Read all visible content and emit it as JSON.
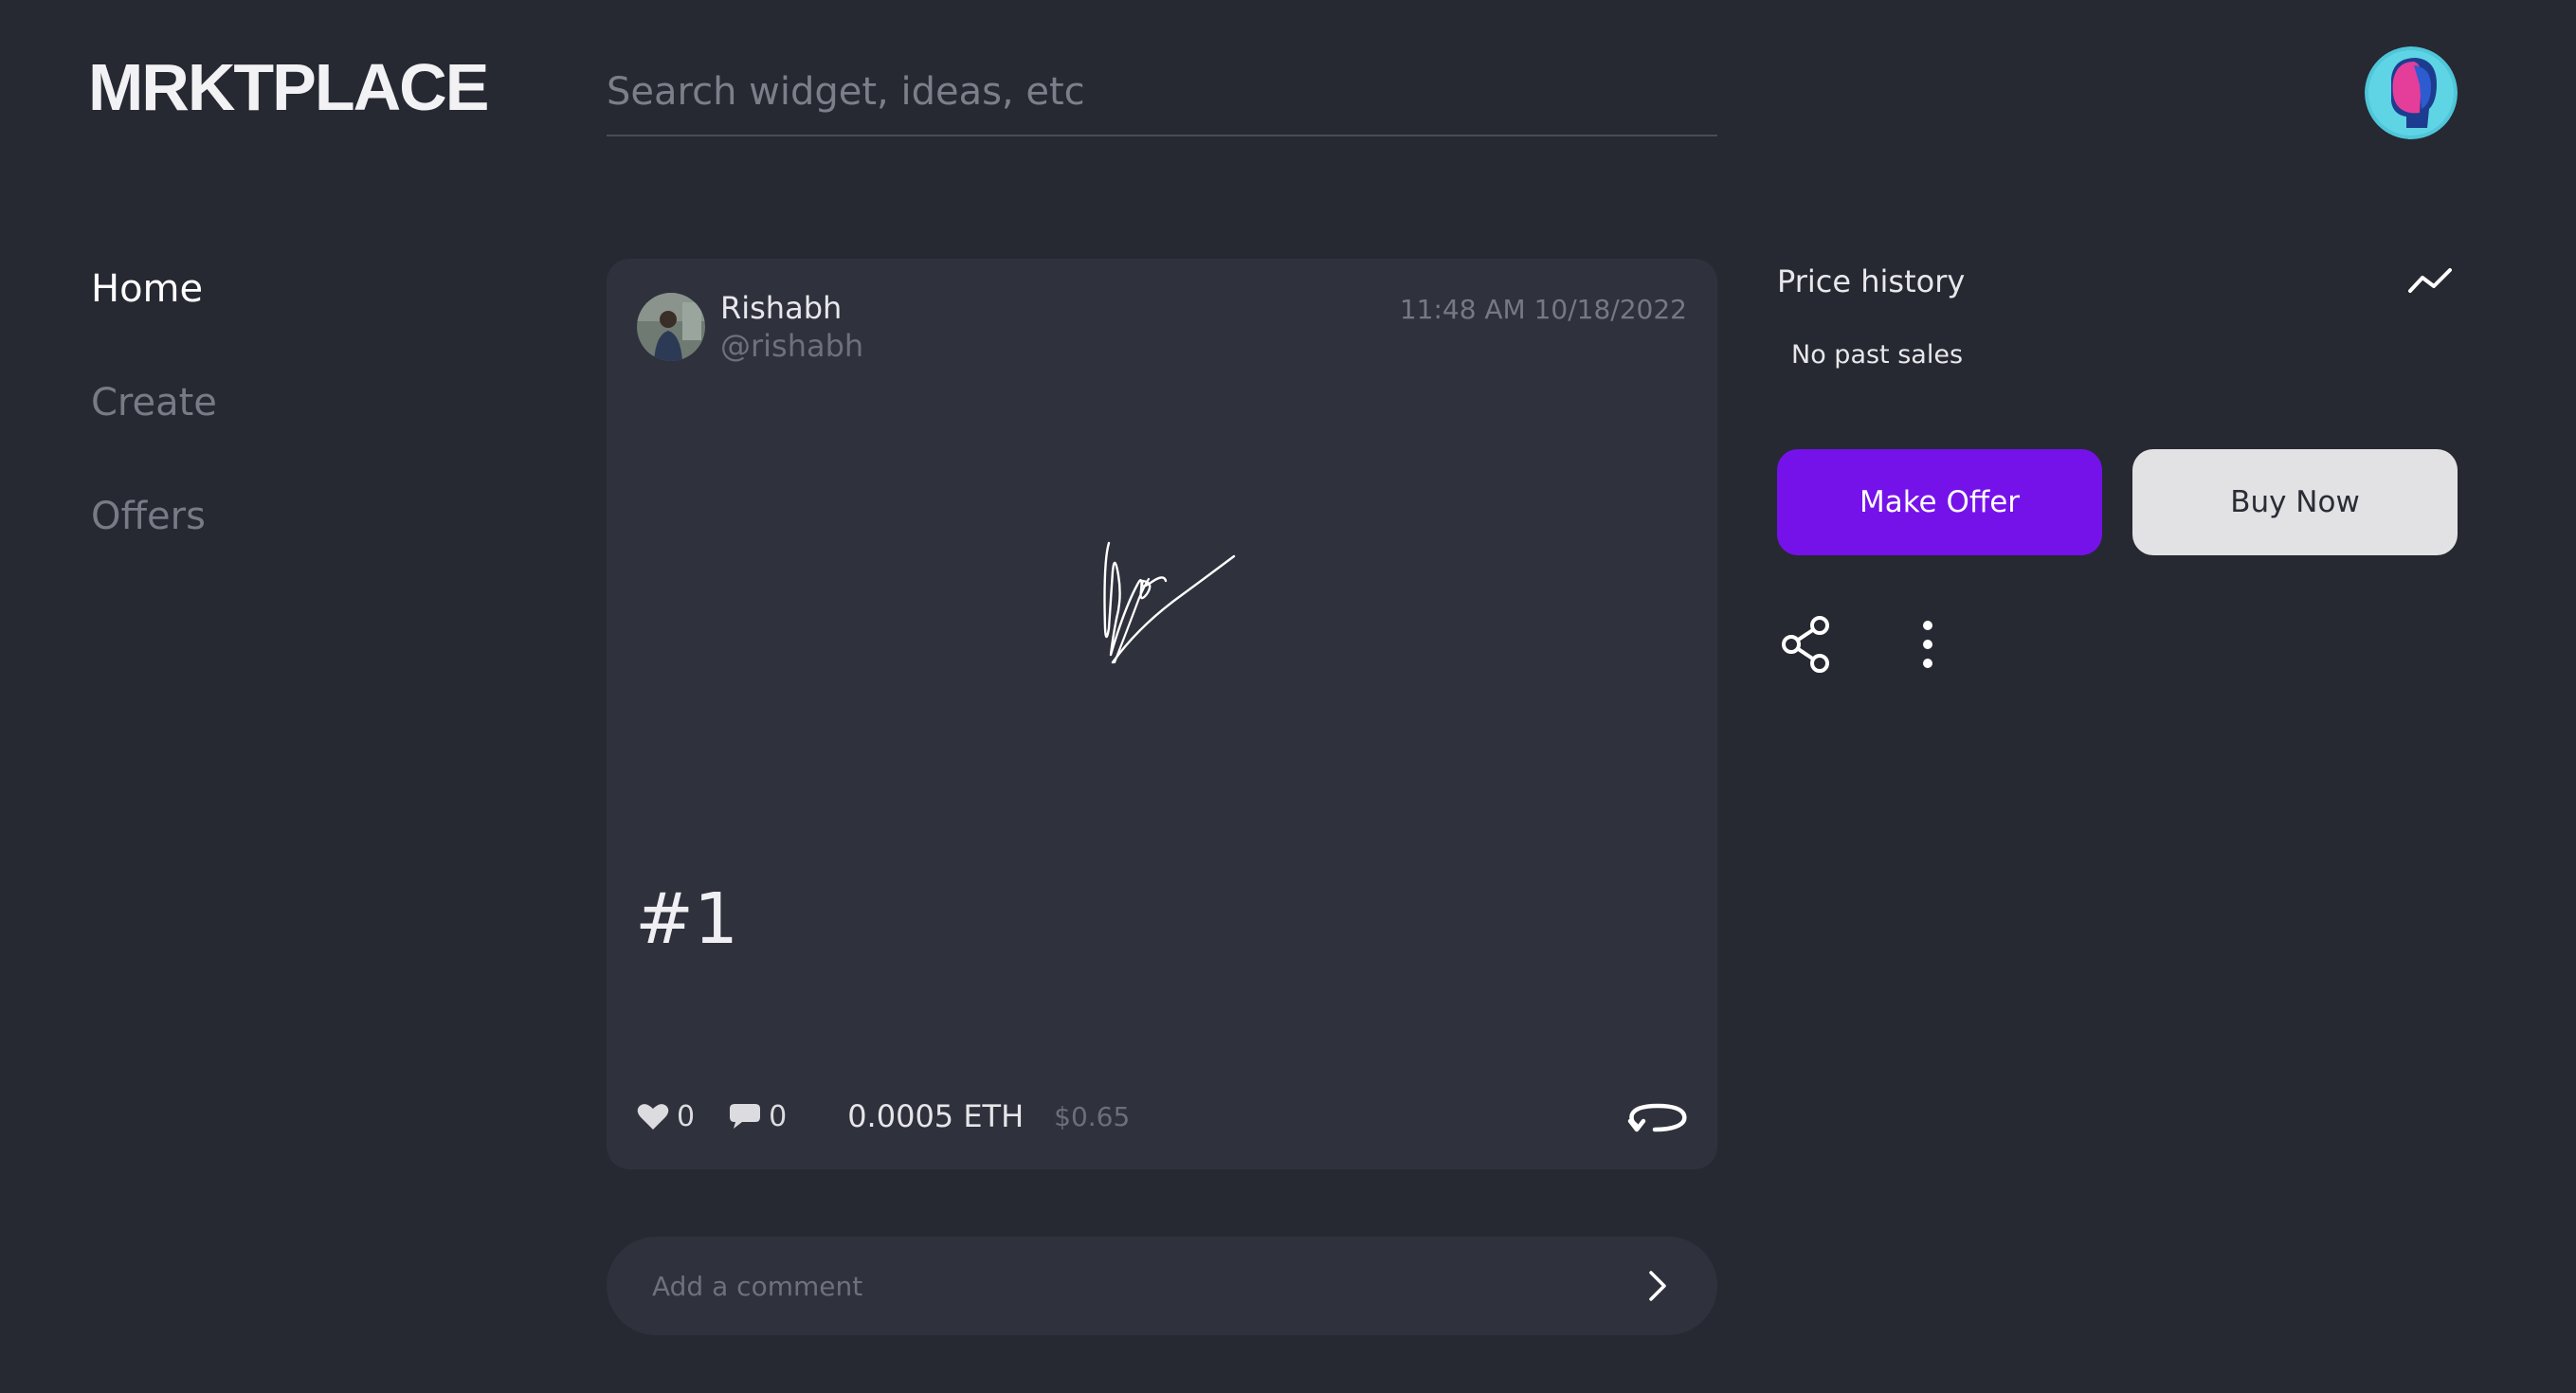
{
  "header": {
    "logo": "MRKTPLACE",
    "search": {
      "placeholder": "Search widget, ideas, etc",
      "value": ""
    },
    "avatar_icon": "user-avatar-icon"
  },
  "sidebar": {
    "items": [
      {
        "label": "Home",
        "active": true
      },
      {
        "label": "Create",
        "active": false
      },
      {
        "label": "Offers",
        "active": false
      }
    ]
  },
  "post": {
    "author_name": "Rishabh",
    "author_handle": "@rishabh",
    "timestamp": "11:48 AM 10/18/2022",
    "title": "#1",
    "likes": "0",
    "comments": "0",
    "price_eth": "0.0005 ETH",
    "price_usd": "$0.65",
    "icons": {
      "like": "heart-icon",
      "comment": "speech-bubble-icon",
      "repost": "repost-icon"
    }
  },
  "comment": {
    "placeholder": "Add a comment",
    "send_icon": "chevron-right-icon"
  },
  "price_panel": {
    "title": "Price history",
    "empty_text": "No past sales",
    "chart_icon": "trend-line-icon"
  },
  "actions": {
    "make_offer": "Make Offer",
    "buy_now": "Buy Now",
    "share_icon": "share-icon",
    "more_icon": "more-vertical-icon"
  },
  "colors": {
    "background": "#262932",
    "card": "#2f313c",
    "accent": "#7512ea",
    "secondary_button": "#e2e2e4",
    "muted_text": "#787b85"
  }
}
